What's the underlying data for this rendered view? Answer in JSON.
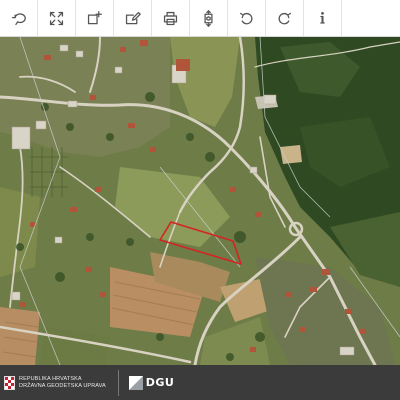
{
  "toolbar": {
    "buttons": [
      {
        "name": "back-button",
        "icon": "undo-loop-icon"
      },
      {
        "name": "fullscreen-button",
        "icon": "expand-arrows-icon"
      },
      {
        "name": "add-area-button",
        "icon": "add-rectangle-icon"
      },
      {
        "name": "edit-area-button",
        "icon": "edit-rectangle-icon"
      },
      {
        "name": "print-button",
        "icon": "printer-icon"
      },
      {
        "name": "zoom-extent-button",
        "icon": "vertical-extent-icon"
      },
      {
        "name": "undo-button",
        "icon": "undo-icon"
      },
      {
        "name": "redo-button",
        "icon": "redo-icon"
      },
      {
        "name": "info-button",
        "icon": "info-icon"
      }
    ],
    "icon_color": "#555555"
  },
  "map": {
    "parcel_outline_color": "#d42424"
  },
  "footer": {
    "org_line1": "REPUBLIKA HRVATSKA",
    "org_line2": "DRŽAVNA GEODETSKA UPRAVA",
    "logo_text": "DGU",
    "background": "#3b3b3b"
  }
}
